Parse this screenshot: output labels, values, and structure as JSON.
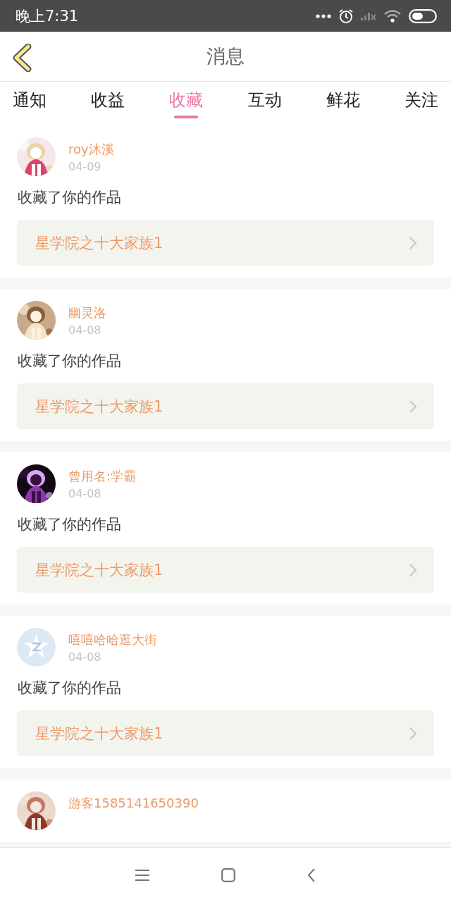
{
  "status_bar": {
    "time": "晚上7:31"
  },
  "header": {
    "title": "消息"
  },
  "tabs": [
    {
      "label": "通知",
      "selected": false
    },
    {
      "label": "收益",
      "selected": false
    },
    {
      "label": "收藏",
      "selected": true
    },
    {
      "label": "互动",
      "selected": false
    },
    {
      "label": "鲜花",
      "selected": false
    },
    {
      "label": "关注",
      "selected": false
    }
  ],
  "messages": [
    {
      "kind": "picture",
      "name": "roy沐溪",
      "date": "04-09",
      "text": "收藏了你的作品",
      "work": "星学院之十大家族1"
    },
    {
      "kind": "picture",
      "name": "幽灵洛",
      "date": "04-08",
      "text": "收藏了你的作品",
      "work": "星学院之十大家族1"
    },
    {
      "kind": "picture",
      "name": "曾用名:学霸",
      "date": "04-08",
      "text": "收藏了你的作品",
      "work": "星学院之十大家族1"
    },
    {
      "kind": "default",
      "name": "嘻嘻哈哈逛大街",
      "date": "04-08",
      "text": "收藏了你的作品",
      "work": "星学院之十大家族1"
    },
    {
      "kind": "picture",
      "name": "游客1585141650390"
    }
  ]
}
